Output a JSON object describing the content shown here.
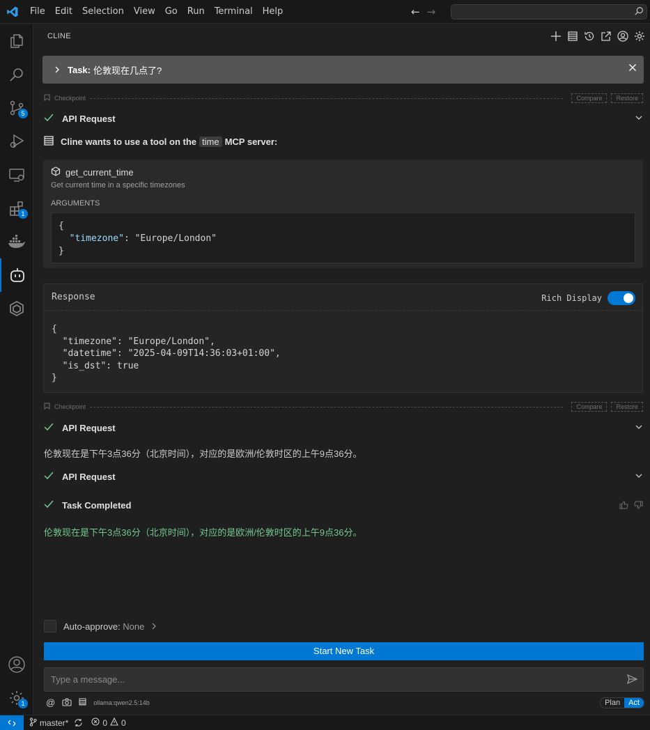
{
  "menu": [
    "File",
    "Edit",
    "Selection",
    "View",
    "Go",
    "Run",
    "Terminal",
    "Help"
  ],
  "icons": {
    "vscode": "vscode-logo-icon",
    "explorer": "files-icon",
    "search": "search-icon",
    "scm": "source-control-icon",
    "debug": "run-debug-icon",
    "remote": "remote-explorer-icon",
    "extensions": "extensions-icon",
    "docker": "docker-icon",
    "cline": "cline-robot-icon",
    "other": "hexagon-icon",
    "account": "account-icon",
    "manage": "gear-icon"
  },
  "badges": {
    "scm": "5",
    "extensions": "1",
    "manage": "1"
  },
  "panel": {
    "title": "CLINE"
  },
  "task": {
    "prefix": "Task:",
    "text": "伦敦现在几点了?"
  },
  "checkpoint": {
    "label": "Checkpoint",
    "compare": "Compare",
    "restore": "Restore"
  },
  "api_request": "API Request",
  "mcp": {
    "before": "Cline wants to use a tool on the",
    "server": "time",
    "after": "MCP server:"
  },
  "tool": {
    "name": "get_current_time",
    "description": "Get current time in a specific timezones",
    "args_label": "ARGUMENTS",
    "args_key": "\"timezone\"",
    "args_value": "\"Europe/London\""
  },
  "response": {
    "title": "Response",
    "rich_display": "Rich Display",
    "rich_enabled": true,
    "lines": [
      "{",
      "  \"timezone\": \"Europe/London\",",
      "  \"datetime\": \"2025-04-09T14:36:03+01:00\",",
      "  \"is_dst\": true",
      "}"
    ]
  },
  "answer": "伦敦现在是下午3点36分（北京时间），对应的是欧洲/伦敦时区的上午9点36分。",
  "task_completed": "Task Completed",
  "completed_text": "伦敦现在是下午3点36分（北京时间），对应的是欧洲/伦敦时区的上午9点36分。",
  "auto_approve": {
    "label": "Auto-approve:",
    "value": "None"
  },
  "start_new_task": "Start New Task",
  "message_placeholder": "Type a message...",
  "footer": {
    "model": "ollama:qwen2.5:14b"
  },
  "mode": {
    "plan": "Plan",
    "act": "Act",
    "active": "Act"
  },
  "status": {
    "branch": "master*",
    "errors": "0",
    "warnings": "0"
  },
  "colors": {
    "accent": "#0078d4",
    "success": "#73c991",
    "task_bar": "#555555"
  }
}
